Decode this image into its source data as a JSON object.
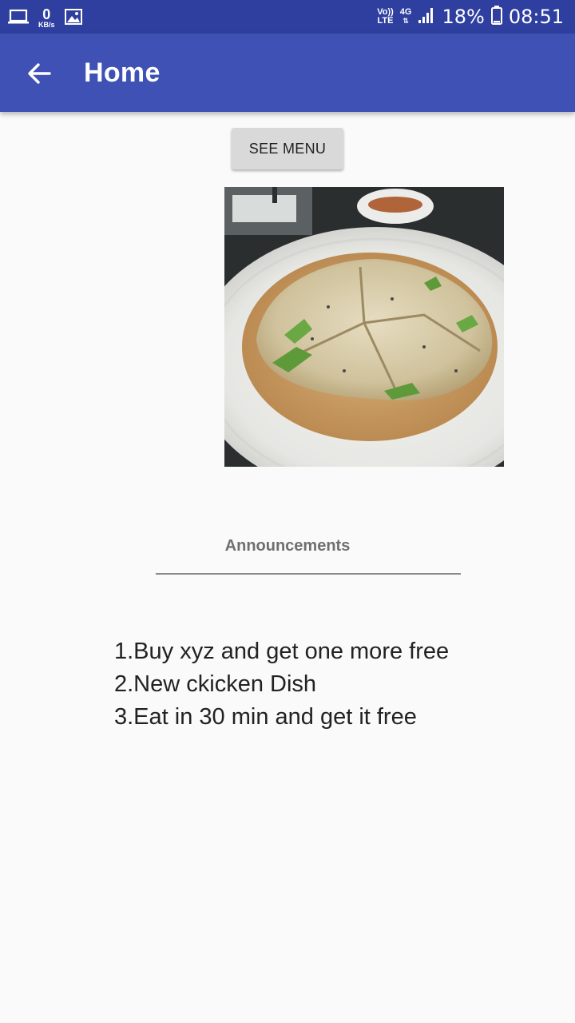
{
  "status_bar": {
    "speed_value": "0",
    "speed_unit": "KB/s",
    "volte_top": "Vo))",
    "volte_bottom": "LTE",
    "network": "4G",
    "battery": "18%",
    "time": "08:51"
  },
  "app_bar": {
    "title": "Home"
  },
  "main": {
    "see_menu_label": "SEE MENU",
    "announcements_title": "Announcements",
    "announcements": [
      "1.Buy xyz and get one more free",
      "2.New ckicken Dish",
      "3.Eat in 30 min and get it free"
    ]
  },
  "colors": {
    "status_bar": "#2f3f9f",
    "app_bar": "#3f51b5",
    "background": "#fafafa",
    "button": "#d9d9d9"
  },
  "icons": [
    "laptop-icon",
    "image-icon",
    "signal-icon",
    "battery-icon",
    "back-arrow-icon"
  ]
}
